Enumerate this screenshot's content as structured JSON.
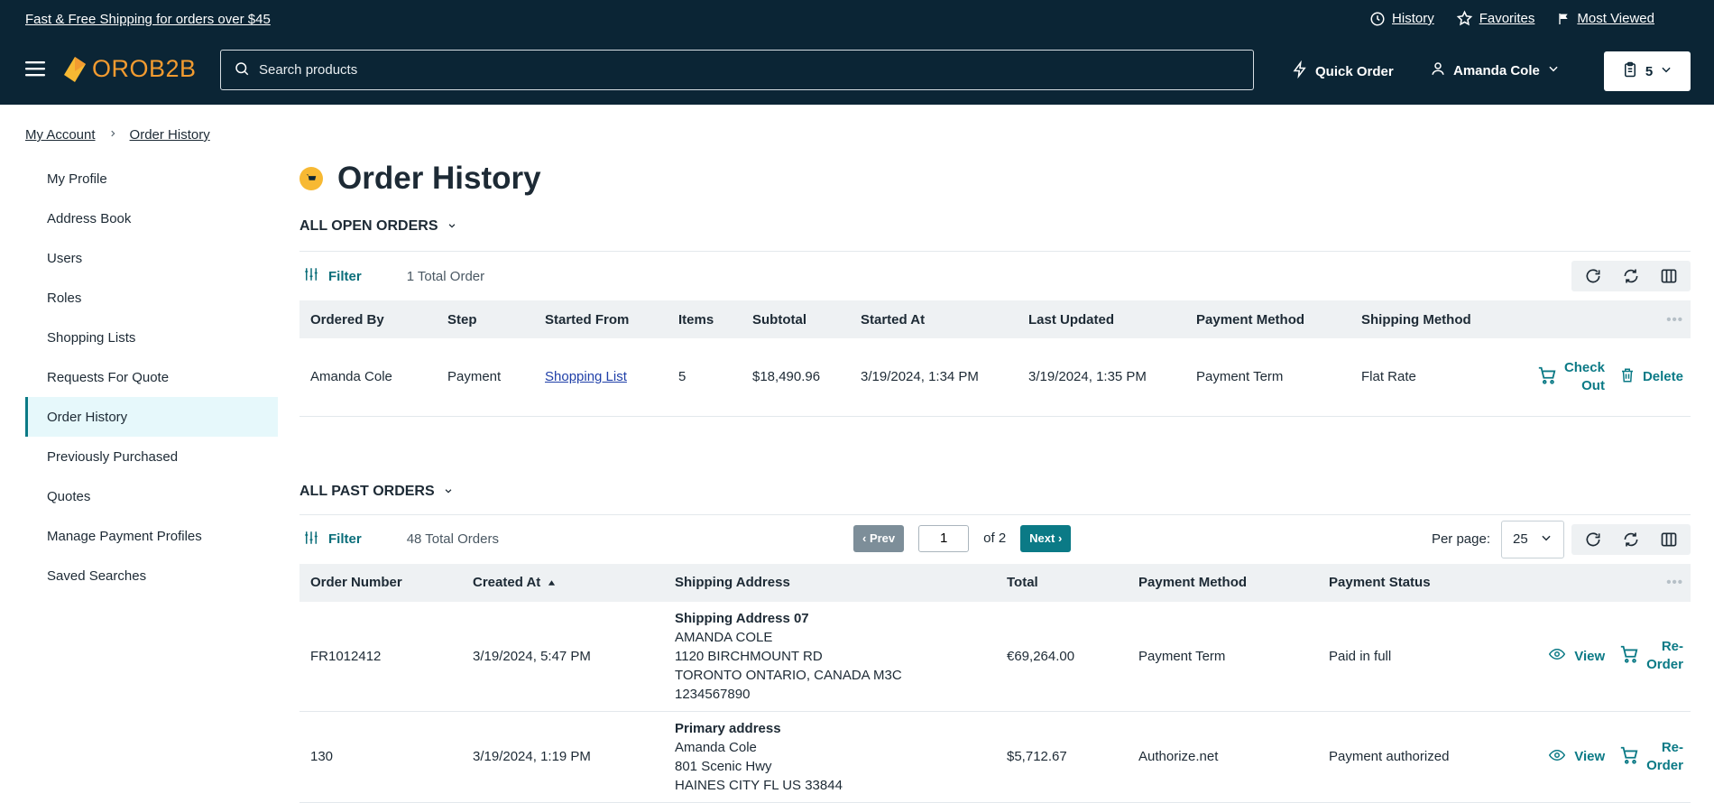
{
  "header": {
    "promo": "Fast & Free Shipping for orders over $45",
    "links": {
      "history": "History",
      "favorites": "Favorites",
      "most_viewed": "Most Viewed"
    },
    "logo": "OROB2B",
    "search_placeholder": "Search products",
    "quick_order": "Quick Order",
    "user_name": "Amanda Cole",
    "cart_count": "5"
  },
  "breadcrumb": {
    "account": "My Account",
    "current": "Order History"
  },
  "sidebar": {
    "items": [
      {
        "label": "My Profile"
      },
      {
        "label": "Address Book"
      },
      {
        "label": "Users"
      },
      {
        "label": "Roles"
      },
      {
        "label": "Shopping Lists"
      },
      {
        "label": "Requests For Quote"
      },
      {
        "label": "Order History"
      },
      {
        "label": "Previously Purchased"
      },
      {
        "label": "Quotes"
      },
      {
        "label": "Manage Payment Profiles"
      },
      {
        "label": "Saved Searches"
      }
    ],
    "active": "Order History"
  },
  "page": {
    "title": "Order History"
  },
  "open_orders": {
    "heading": "ALL OPEN ORDERS",
    "filter": "Filter",
    "total": "1 Total Order",
    "columns": [
      "Ordered By",
      "Step",
      "Started From",
      "Items",
      "Subtotal",
      "Started At",
      "Last Updated",
      "Payment Method",
      "Shipping Method"
    ],
    "row": {
      "ordered_by": "Amanda Cole",
      "step": "Payment",
      "started_from": "Shopping List",
      "items": "5",
      "subtotal": "$18,490.96",
      "started_at": "3/19/2024, 1:34 PM",
      "last_updated": "3/19/2024, 1:35 PM",
      "payment_method": "Payment Term",
      "shipping_method": "Flat Rate",
      "checkout_l1": "Check",
      "checkout_l2": "Out",
      "delete": "Delete"
    }
  },
  "past_orders": {
    "heading": "ALL PAST ORDERS",
    "filter": "Filter",
    "total": "48 Total Orders",
    "pager": {
      "prev": "‹ Prev",
      "page": "1",
      "of": "of 2",
      "next": "Next ›"
    },
    "per_page_label": "Per page:",
    "per_page": "25",
    "columns": [
      "Order Number",
      "Created At",
      "Shipping Address",
      "Total",
      "Payment Method",
      "Payment Status"
    ],
    "rows": [
      {
        "number": "FR1012412",
        "created": "3/19/2024, 5:47 PM",
        "addr_title": "Shipping Address 07",
        "addr_l1": "AMANDA COLE",
        "addr_l2": "1120 BIRCHMOUNT RD",
        "addr_l3": "TORONTO ONTARIO, CANADA M3C",
        "addr_l4": "1234567890",
        "total": "€69,264.00",
        "payment_method": "Payment Term",
        "payment_status": "Paid in full",
        "view": "View",
        "reorder_l1": "Re-",
        "reorder_l2": "Order"
      },
      {
        "number": "130",
        "created": "3/19/2024, 1:19 PM",
        "addr_title": "Primary address",
        "addr_l1": "Amanda Cole",
        "addr_l2": "801 Scenic Hwy",
        "addr_l3": "HAINES CITY FL US 33844",
        "addr_l4": "",
        "total": "$5,712.67",
        "payment_method": "Authorize.net",
        "payment_status": "Payment authorized",
        "view": "View",
        "reorder_l1": "Re-",
        "reorder_l2": "Order"
      }
    ]
  }
}
